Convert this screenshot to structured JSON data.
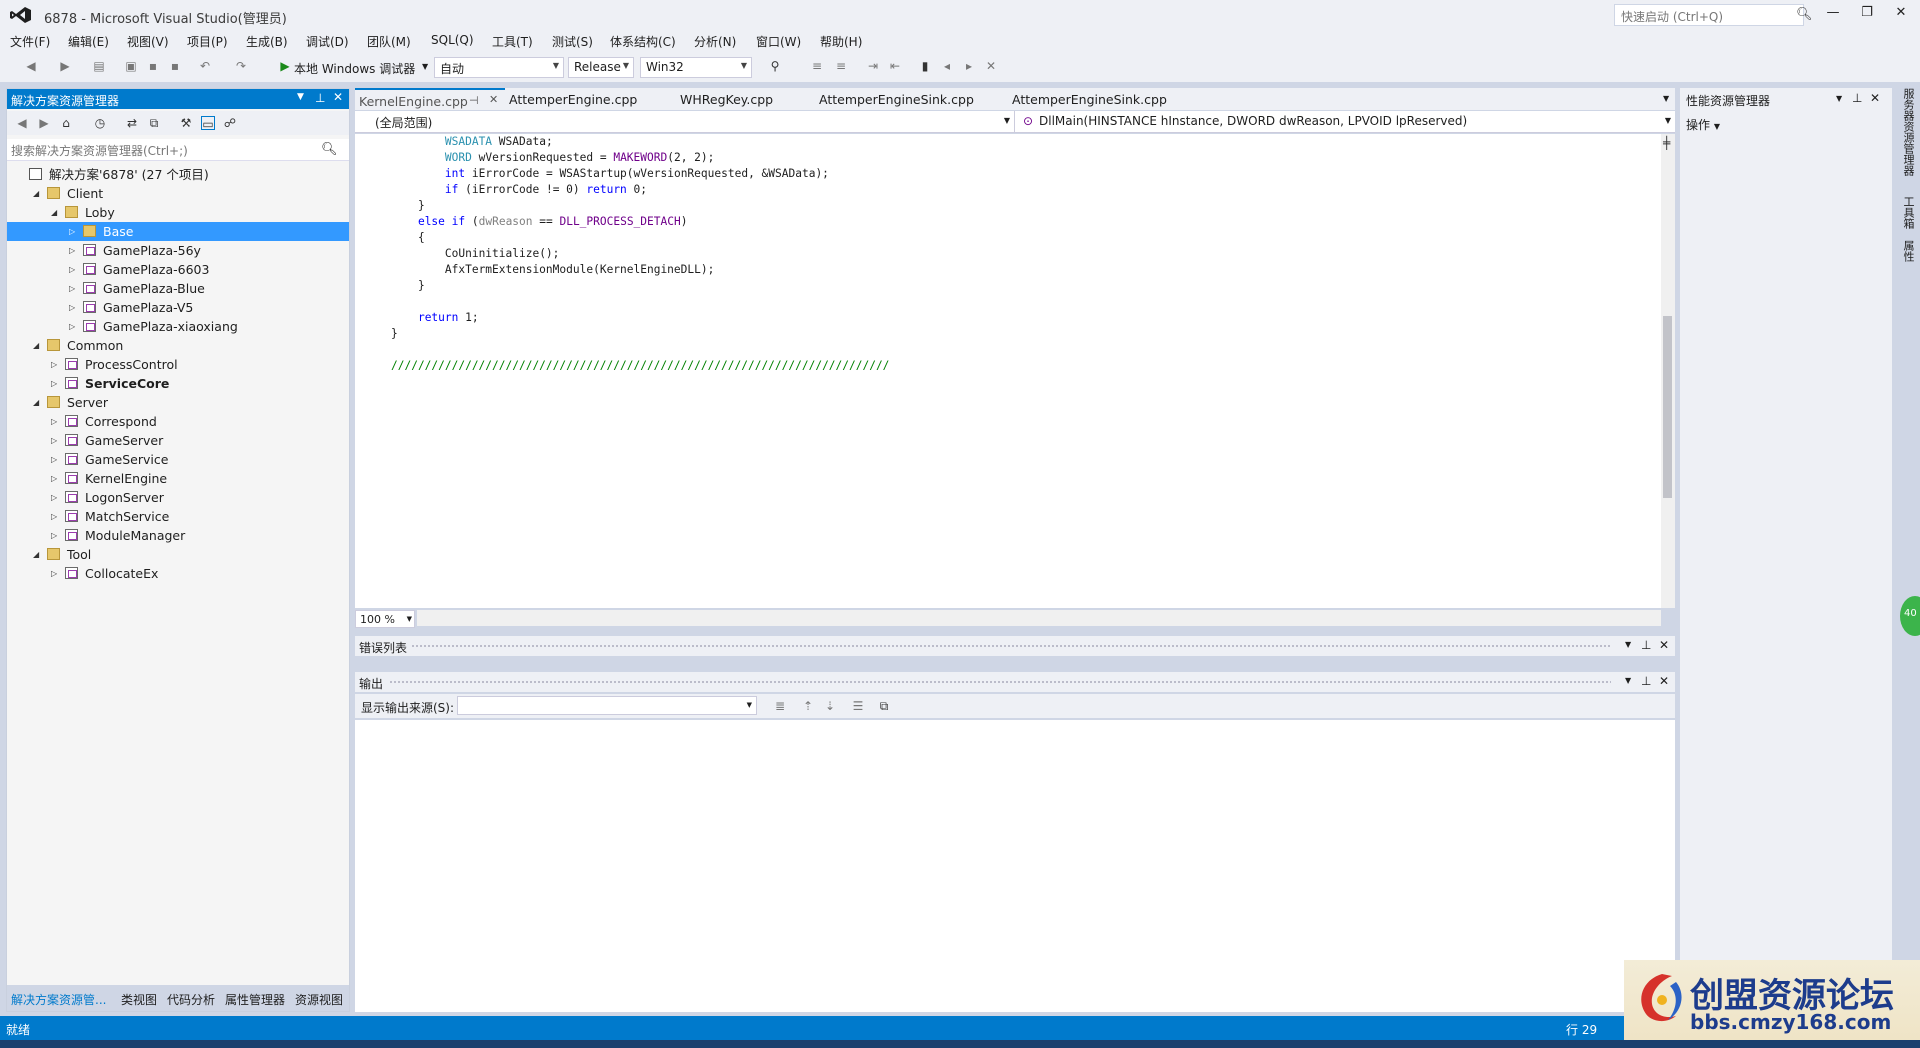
{
  "window": {
    "title": "6878 - Microsoft Visual Studio(管理员)",
    "quick_launch_placeholder": "快速启动 (Ctrl+Q)"
  },
  "menu": [
    "文件(F)",
    "编辑(E)",
    "视图(V)",
    "项目(P)",
    "生成(B)",
    "调试(D)",
    "团队(M)",
    "SQL(Q)",
    "工具(T)",
    "测试(S)",
    "体系结构(C)",
    "分析(N)",
    "窗口(W)",
    "帮助(H)"
  ],
  "toolbar": {
    "debugger_label": "本地 Windows 调试器",
    "mode_combo": "自动",
    "config_combo": "Release",
    "platform_combo": "Win32"
  },
  "solution_explorer": {
    "title": "解决方案资源管理器",
    "search_placeholder": "搜索解决方案资源管理器(Ctrl+;)",
    "tree": [
      {
        "label": "解决方案'6878' (27 个项目)",
        "level": 0,
        "icon": "solution",
        "expander": ""
      },
      {
        "label": "Client",
        "level": 1,
        "icon": "folder",
        "expander": "◢"
      },
      {
        "label": "Loby",
        "level": 2,
        "icon": "folder",
        "expander": "◢"
      },
      {
        "label": "Base",
        "level": 3,
        "icon": "folder",
        "expander": "▷",
        "selected": true
      },
      {
        "label": "GamePlaza-56y",
        "level": 3,
        "icon": "project",
        "expander": "▷"
      },
      {
        "label": "GamePlaza-6603",
        "level": 3,
        "icon": "project",
        "expander": "▷"
      },
      {
        "label": "GamePlaza-Blue",
        "level": 3,
        "icon": "project",
        "expander": "▷"
      },
      {
        "label": "GamePlaza-V5",
        "level": 3,
        "icon": "project",
        "expander": "▷"
      },
      {
        "label": "GamePlaza-xiaoxiang",
        "level": 3,
        "icon": "project",
        "expander": "▷"
      },
      {
        "label": "Common",
        "level": 1,
        "icon": "folder",
        "expander": "◢"
      },
      {
        "label": "ProcessControl",
        "level": 2,
        "icon": "project",
        "expander": "▷"
      },
      {
        "label": "ServiceCore",
        "level": 2,
        "icon": "project",
        "expander": "▷",
        "bold": true
      },
      {
        "label": "Server",
        "level": 1,
        "icon": "folder",
        "expander": "◢"
      },
      {
        "label": "Correspond",
        "level": 2,
        "icon": "project",
        "expander": "▷"
      },
      {
        "label": "GameServer",
        "level": 2,
        "icon": "project",
        "expander": "▷"
      },
      {
        "label": "GameService",
        "level": 2,
        "icon": "project",
        "expander": "▷"
      },
      {
        "label": "KernelEngine",
        "level": 2,
        "icon": "project",
        "expander": "▷"
      },
      {
        "label": "LogonServer",
        "level": 2,
        "icon": "project",
        "expander": "▷"
      },
      {
        "label": "MatchService",
        "level": 2,
        "icon": "project",
        "expander": "▷"
      },
      {
        "label": "ModuleManager",
        "level": 2,
        "icon": "project",
        "expander": "▷"
      },
      {
        "label": "Tool",
        "level": 1,
        "icon": "folder",
        "expander": "◢"
      },
      {
        "label": "CollocateEx",
        "level": 2,
        "icon": "project",
        "expander": "▷"
      }
    ],
    "bottom_tabs": [
      "解决方案资源管...",
      "类视图",
      "代码分析",
      "属性管理器",
      "资源视图"
    ]
  },
  "editor": {
    "tabs": [
      "KernelEngine.cpp",
      "AttemperEngine.cpp",
      "WHRegKey.cpp",
      "AttemperEngineSink.cpp",
      "AttemperEngineSink.cpp"
    ],
    "scope_left": "(全局范围)",
    "scope_right": "DllMain(HINSTANCE hInstance, DWORD dwReason, LPVOID lpReserved)",
    "zoom": "100 %",
    "code_lines": [
      "        WSADATA WSAData;",
      "        WORD wVersionRequested = MAKEWORD(2, 2);",
      "        int iErrorCode = WSAStartup(wVersionRequested, &WSAData);",
      "        if (iErrorCode != 0) return 0;",
      "    }",
      "    else if (dwReason == DLL_PROCESS_DETACH)",
      "    {",
      "        CoUninitialize();",
      "        AfxTermExtensionModule(KernelEngineDLL);",
      "    }",
      "",
      "    return 1;",
      "}",
      "",
      "//////////////////////////////////////////////////////////////////////////"
    ]
  },
  "error_list": {
    "title": "错误列表"
  },
  "output": {
    "title": "输出",
    "source_label": "显示输出来源(S):"
  },
  "perf_panel": {
    "title": "性能资源管理器",
    "actions_label": "操作"
  },
  "side_tabs": [
    "服务器资源管理器",
    "工具箱",
    "属性"
  ],
  "status": {
    "left": "就绪",
    "line": "行 29"
  },
  "watermark": {
    "cn": "创盟资源论坛",
    "url": "bbs.cmzy168.com"
  },
  "badge": "40"
}
